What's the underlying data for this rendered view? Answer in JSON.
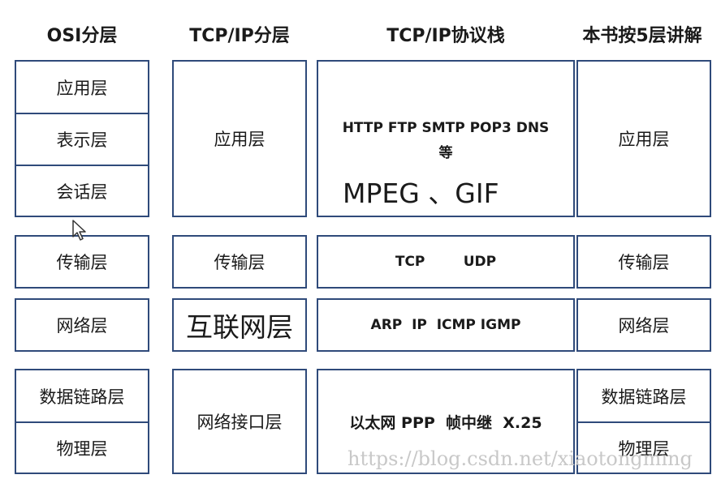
{
  "headers": {
    "osi": "OSI分层",
    "tcpip": "TCP/IP分层",
    "stack": "TCP/IP协议栈",
    "book": "本书按5层讲解"
  },
  "osi_layers": {
    "application": "应用层",
    "presentation": "表示层",
    "session": "会话层",
    "transport": "传输层",
    "network": "网络层",
    "datalink": "数据链路层",
    "physical": "物理层"
  },
  "tcpip_layers": {
    "application": "应用层",
    "transport": "传输层",
    "internet": "互联网层",
    "network_interface": "网络接口层"
  },
  "protocols": {
    "application_line1": "HTTP FTP SMTP POP3 DNS",
    "application_line2": "等",
    "application_extra": "MPEG 、GIF",
    "transport": "TCP        UDP",
    "network": "ARP  IP  ICMP IGMP",
    "link": "以太网 PPP  帧中继  X.25"
  },
  "book_layers": {
    "application": "应用层",
    "transport": "传输层",
    "network": "网络层",
    "datalink": "数据链路层",
    "physical": "物理层"
  },
  "watermark": "https://blog.csdn.net/xiaotongming"
}
